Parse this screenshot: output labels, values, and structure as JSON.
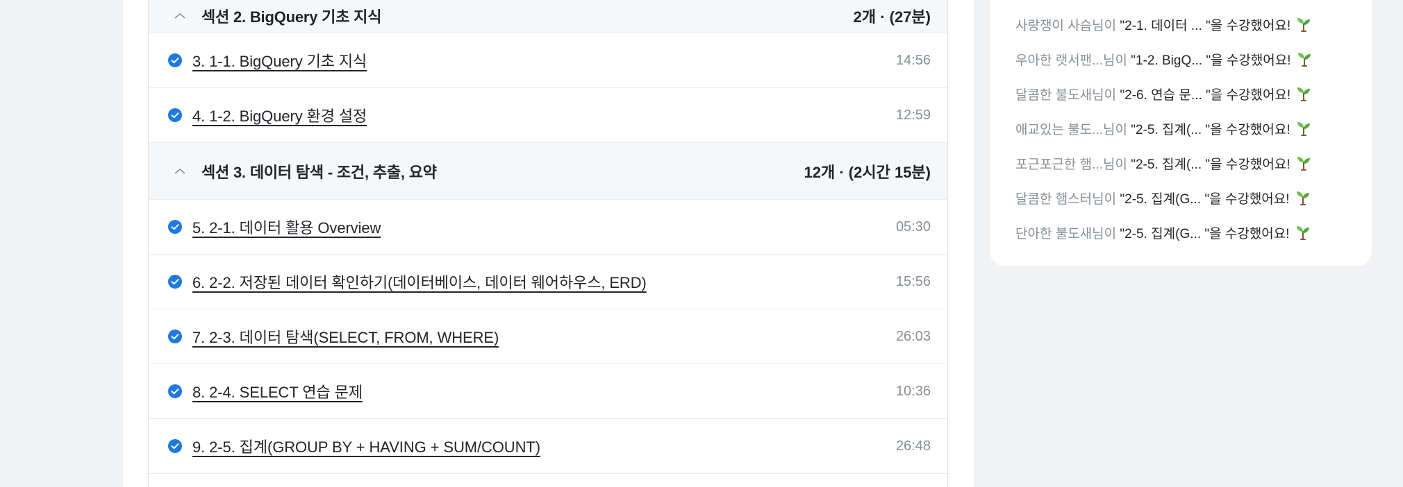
{
  "sections": [
    {
      "title": "섹션 2. BigQuery 기초 지식",
      "meta": "2개 · (27분)",
      "lectures": [
        {
          "title": "3. 1-1. BigQuery 기초 지식",
          "time": "14:56"
        },
        {
          "title": "4. 1-2. BigQuery 환경 설정",
          "time": "12:59"
        }
      ]
    },
    {
      "title": "섹션 3. 데이터 탐색 - 조건, 추출, 요약",
      "meta": "12개 · (2시간 15분)",
      "lectures": [
        {
          "title": "5. 2-1. 데이터 활용 Overview",
          "time": "05:30"
        },
        {
          "title": "6. 2-2. 저장된 데이터 확인하기(데이터베이스, 데이터 웨어하우스, ERD)",
          "time": "15:56"
        },
        {
          "title": "7. 2-3. 데이터 탐색(SELECT, FROM, WHERE)",
          "time": "26:03"
        },
        {
          "title": "8. 2-4. SELECT 연습 문제",
          "time": "10:36"
        },
        {
          "title": "9. 2-5. 집계(GROUP BY + HAVING + SUM/COUNT)",
          "time": "26:48"
        }
      ]
    }
  ],
  "feed": [
    {
      "user": "사랑쟁이 사슴님이",
      "text": "\"2-1. 데이터 ... \"을 수강했어요!"
    },
    {
      "user": "우아한 랫서팬...님이",
      "text": "\"1-2. BigQ... \"을 수강했어요!"
    },
    {
      "user": "달콤한 불도새님이",
      "text": "\"2-6. 연습 문... \"을 수강했어요!"
    },
    {
      "user": "애교있는 불도...님이",
      "text": "\"2-5. 집계(... \"을 수강했어요!"
    },
    {
      "user": "포근포근한 햄...님이",
      "text": "\"2-5. 집계(... \"을 수강했어요!"
    },
    {
      "user": "달콤한 햄스터님이",
      "text": "\"2-5. 집계(G... \"을 수강했어요!"
    },
    {
      "user": "단아한 불도새님이",
      "text": "\"2-5. 집계(G... \"을 수강했어요!"
    }
  ],
  "icons": {
    "check": "check-circle-icon",
    "chevron": "chevron-up-icon",
    "sprout": "sprout-icon"
  },
  "colors": {
    "accent": "#1f7ae0",
    "sprout_leaf": "#6cc24a",
    "sprout_stem": "#7b5a3a"
  }
}
